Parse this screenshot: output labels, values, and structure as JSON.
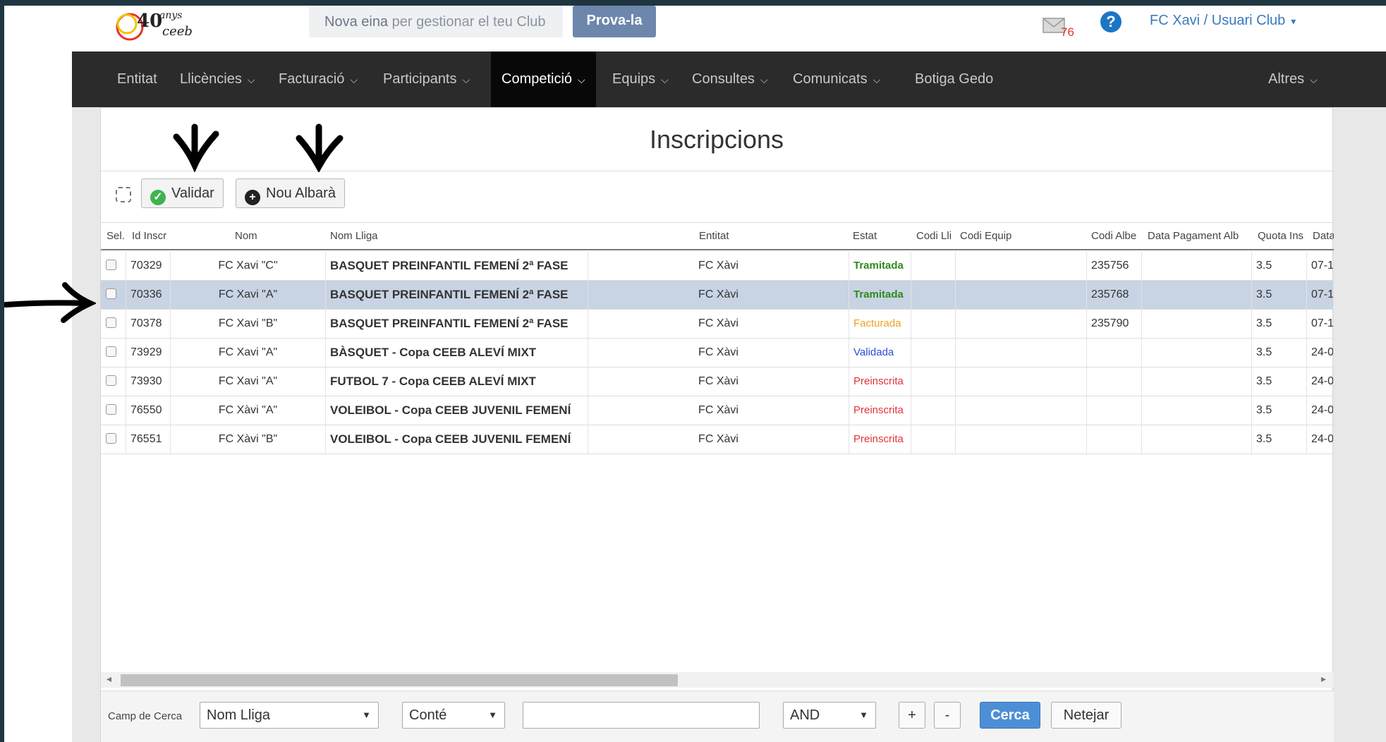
{
  "header": {
    "promo_text_bold": "Nova eina",
    "promo_text_rest": " per gestionar el teu Club",
    "try_button": "Prova-la",
    "mail_count": "76",
    "help_glyph": "?",
    "user_menu": "FC Xavi / Usuari Club",
    "logo_text": "40anys",
    "logo_sub": "ceeb"
  },
  "nav": {
    "items": [
      {
        "label": "Entitat",
        "has_caret": false
      },
      {
        "label": "Llicències",
        "has_caret": true
      },
      {
        "label": "Facturació",
        "has_caret": true
      },
      {
        "label": "Participants",
        "has_caret": true
      },
      {
        "label": "Competició",
        "has_caret": true,
        "active": true
      },
      {
        "label": "Equips",
        "has_caret": true
      },
      {
        "label": "Consultes",
        "has_caret": true
      },
      {
        "label": "Comunicats",
        "has_caret": true
      },
      {
        "label": "Botiga Gedo",
        "has_caret": false
      },
      {
        "label": "Altres",
        "has_caret": true
      }
    ]
  },
  "page": {
    "title": "Inscripcions",
    "validar_label": "Validar",
    "nou_albara_label": "Nou Albarà"
  },
  "table": {
    "headers": [
      "Sel.",
      "Id Inscr",
      "Nom",
      "Nom Lliga",
      "Entitat",
      "Estat",
      "Codi Lli",
      "Codi Equip",
      "Codi Albe",
      "Data Pagament Alb",
      "Quota Ins",
      "Data"
    ],
    "rows": [
      {
        "id": "70329",
        "nom": "FC Xavi \"C\"",
        "lliga": "BASQUET PREINFANTIL FEMENÍ 2ª FASE",
        "entitat": "FC Xàvi",
        "estat": "Tramitada",
        "codi_albara": "235756",
        "quota": "3.5",
        "data": "07-1"
      },
      {
        "id": "70336",
        "nom": "FC Xavi \"A\"",
        "lliga": "BASQUET PREINFANTIL FEMENÍ 2ª FASE",
        "entitat": "FC Xàvi",
        "estat": "Tramitada",
        "codi_albara": "235768",
        "quota": "3.5",
        "data": "07-1"
      },
      {
        "id": "70378",
        "nom": "FC Xavi \"B\"",
        "lliga": "BASQUET PREINFANTIL FEMENÍ 2ª FASE",
        "entitat": "FC Xàvi",
        "estat": "Facturada",
        "codi_albara": "235790",
        "quota": "3.5",
        "data": "07-1"
      },
      {
        "id": "73929",
        "nom": "FC Xavi \"A\"",
        "lliga": "BÀSQUET - Copa CEEB ALEVÍ MIXT",
        "entitat": "FC Xàvi",
        "estat": "Validada",
        "codi_albara": "",
        "quota": "3.5",
        "data": "24-0"
      },
      {
        "id": "73930",
        "nom": "FC Xavi \"A\"",
        "lliga": "FUTBOL 7 - Copa CEEB ALEVÍ MIXT",
        "entitat": "FC Xàvi",
        "estat": "Preinscrita",
        "codi_albara": "",
        "quota": "3.5",
        "data": "24-0"
      },
      {
        "id": "76550",
        "nom": "FC Xàvi \"A\"",
        "lliga": "VOLEIBOL - Copa CEEB JUVENIL FEMENÍ",
        "entitat": "FC Xàvi",
        "estat": "Preinscrita",
        "codi_albara": "",
        "quota": "3.5",
        "data": "24-0"
      },
      {
        "id": "76551",
        "nom": "FC Xàvi \"B\"",
        "lliga": "VOLEIBOL - Copa CEEB JUVENIL FEMENÍ",
        "entitat": "FC Xàvi",
        "estat": "Preinscrita",
        "codi_albara": "",
        "quota": "3.5",
        "data": "24-0"
      }
    ],
    "highlighted_row": 1
  },
  "status_colors": {
    "Tramitada": "#2e8b1e",
    "Facturada": "#f0a020",
    "Validada": "#2a4fcf",
    "Preinscrita": "#e0343c"
  },
  "search": {
    "label": "Camp de Cerca",
    "field": "Nom Lliga",
    "operator": "Conté",
    "value": "",
    "logic": "AND",
    "add": "+",
    "remove": "-",
    "search_button": "Cerca",
    "clear_button": "Netejar"
  }
}
